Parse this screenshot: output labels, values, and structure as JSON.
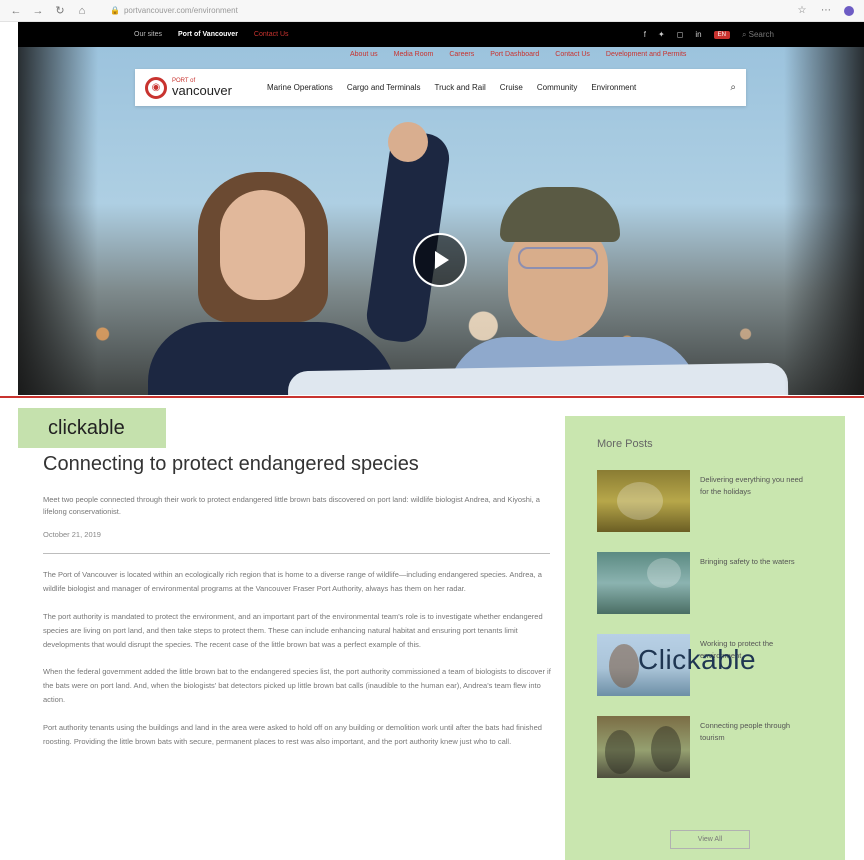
{
  "browser": {
    "back": "←",
    "forward": "→",
    "reload": "↻",
    "home": "⌂",
    "url": "portvancouver.com/environment"
  },
  "topbar": {
    "link1": "Our sites",
    "link2": "Port of Vancouver",
    "link3": "Contact Us",
    "lang": "EN",
    "search": "Search"
  },
  "secondary_nav": [
    "About us",
    "Media Room",
    "Careers",
    "Port Dashboard",
    "Contact Us",
    "Development and Permits"
  ],
  "logo": {
    "port_of": "PORT of",
    "vancouver": "vancouver"
  },
  "main_nav": [
    "Marine Operations",
    "Cargo and Terminals",
    "Truck and Rail",
    "Cruise",
    "Community",
    "Environment"
  ],
  "overlays": {
    "left": "clickable",
    "right": "Clickable"
  },
  "article": {
    "title": "Connecting to protect endangered species",
    "lead": "Meet two people connected through their work to protect endangered little brown bats discovered on port land: wildlife biologist Andrea, and Kiyoshi, a lifelong conservationist.",
    "date": "October 21, 2019",
    "paragraphs": [
      "The Port of Vancouver is located within an ecologically rich region that is home to a diverse range of wildlife—including endangered species. Andrea, a wildlife biologist and manager of environmental programs at the Vancouver Fraser Port Authority, always has them on her radar.",
      "The port authority is mandated to protect the environment, and an important part of the environmental team's role is to investigate whether endangered species are living on port land, and then take steps to protect them. These can include enhancing natural habitat and ensuring port tenants limit developments that would disrupt the species. The recent case of the little brown bat was a perfect example of this.",
      "When the federal government added the little brown bat to the endangered species list, the port authority commissioned a team of biologists to discover if the bats were on port land. And, when the biologists' bat detectors picked up little brown bat calls (inaudible to the human ear), Andrea's team flew into action.",
      "Port authority tenants using the buildings and land in the area were asked to hold off on any building or demolition work until after the bats had finished roosting. Providing the little brown bats with secure, permanent places to rest was also important, and the port authority knew just who to call."
    ]
  },
  "sidebar": {
    "heading": "More Posts",
    "posts": [
      {
        "title": "Delivering everything you need for the holidays"
      },
      {
        "title": "Bringing safety to the waters"
      },
      {
        "title": "Working to protect the environment"
      },
      {
        "title": "Connecting people through tourism"
      }
    ],
    "view_all": "View All"
  },
  "icons": {
    "play": "play-icon",
    "search": "search-icon",
    "facebook": "facebook-icon",
    "twitter": "twitter-icon",
    "instagram": "instagram-icon",
    "linkedin": "linkedin-icon"
  },
  "colors": {
    "brand_red": "#c8332f",
    "highlight_green": "#c9e6af",
    "overlay_text": "#1f3652"
  }
}
